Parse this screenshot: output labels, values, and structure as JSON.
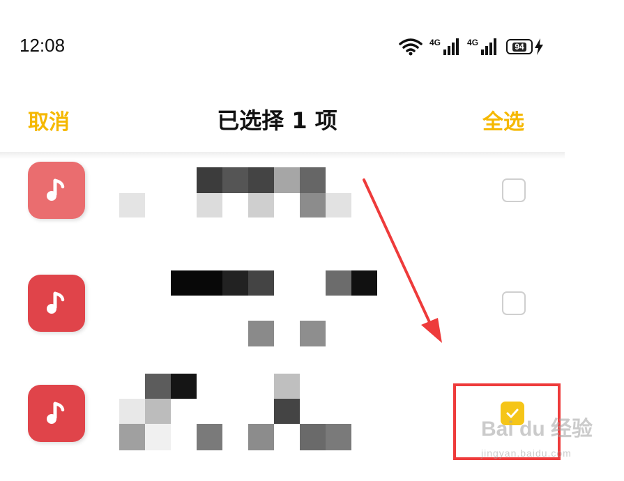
{
  "status_bar": {
    "time": "12:08",
    "network_1": "4G",
    "network_2": "4G",
    "battery_level": "94",
    "icons": [
      "wifi-icon",
      "signal-icon",
      "signal-icon",
      "battery-icon",
      "charging-icon"
    ]
  },
  "nav": {
    "cancel_label": "取消",
    "title": "已选择 1 项",
    "select_all_label": "全选"
  },
  "items": [
    {
      "icon": "music-note-icon",
      "checked": false
    },
    {
      "icon": "music-note-icon",
      "checked": false
    },
    {
      "icon": "music-note-icon",
      "checked": true
    }
  ],
  "colors": {
    "accent": "#f5b800",
    "app_icon": "#e0444a",
    "checkbox_checked": "#f5c518",
    "annotation": "#ee3b3b"
  },
  "watermark": {
    "brand": "Bai du 经验",
    "url": "jingyan.baidu.com"
  }
}
